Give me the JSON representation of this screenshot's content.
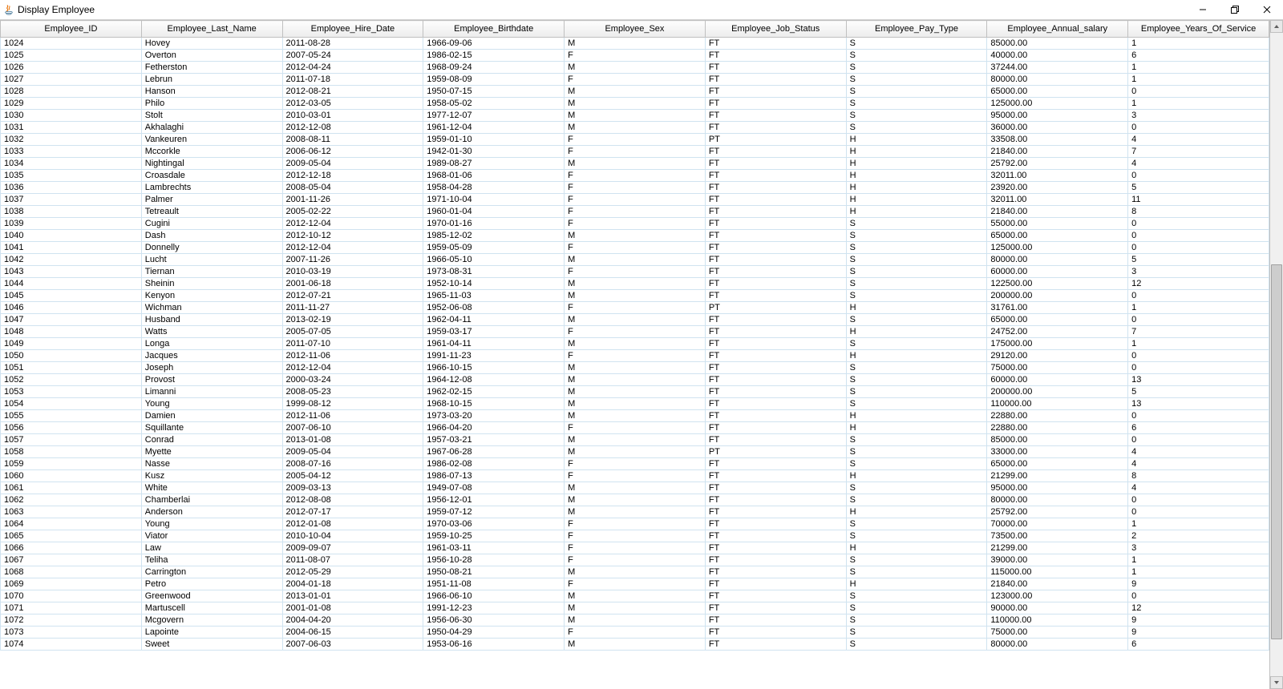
{
  "window": {
    "title": "Display Employee"
  },
  "columns": [
    "Employee_ID",
    "Employee_Last_Name",
    "Employee_Hire_Date",
    "Employee_Birthdate",
    "Employee_Sex",
    "Employee_Job_Status",
    "Employee_Pay_Type",
    "Employee_Annual_salary",
    "Employee_Years_Of_Service"
  ],
  "rows": [
    [
      "1024",
      "Hovey",
      "2011-08-28",
      "1966-09-06",
      "M",
      "FT",
      "S",
      "85000.00",
      "1"
    ],
    [
      "1025",
      "Overton",
      "2007-05-24",
      "1986-02-15",
      "F",
      "FT",
      "S",
      "40000.00",
      "6"
    ],
    [
      "1026",
      "Fetherston",
      "2012-04-24",
      "1968-09-24",
      "M",
      "FT",
      "S",
      "37244.00",
      "1"
    ],
    [
      "1027",
      "Lebrun",
      "2011-07-18",
      "1959-08-09",
      "F",
      "FT",
      "S",
      "80000.00",
      "1"
    ],
    [
      "1028",
      "Hanson",
      "2012-08-21",
      "1950-07-15",
      "M",
      "FT",
      "S",
      "65000.00",
      "0"
    ],
    [
      "1029",
      "Philo",
      "2012-03-05",
      "1958-05-02",
      "M",
      "FT",
      "S",
      "125000.00",
      "1"
    ],
    [
      "1030",
      "Stolt",
      "2010-03-01",
      "1977-12-07",
      "M",
      "FT",
      "S",
      "95000.00",
      "3"
    ],
    [
      "1031",
      "Akhalaghi",
      "2012-12-08",
      "1961-12-04",
      "M",
      "FT",
      "S",
      "36000.00",
      "0"
    ],
    [
      "1032",
      "Vankeuren",
      "2008-08-11",
      "1959-01-10",
      "F",
      "PT",
      "H",
      "33508.00",
      "4"
    ],
    [
      "1033",
      "Mccorkle",
      "2006-06-12",
      "1942-01-30",
      "F",
      "FT",
      "H",
      "21840.00",
      "7"
    ],
    [
      "1034",
      "Nightingal",
      "2009-05-04",
      "1989-08-27",
      "M",
      "FT",
      "H",
      "25792.00",
      "4"
    ],
    [
      "1035",
      "Croasdale",
      "2012-12-18",
      "1968-01-06",
      "F",
      "FT",
      "H",
      "32011.00",
      "0"
    ],
    [
      "1036",
      "Lambrechts",
      "2008-05-04",
      "1958-04-28",
      "F",
      "FT",
      "H",
      "23920.00",
      "5"
    ],
    [
      "1037",
      "Palmer",
      "2001-11-26",
      "1971-10-04",
      "F",
      "FT",
      "H",
      "32011.00",
      "11"
    ],
    [
      "1038",
      "Tetreault",
      "2005-02-22",
      "1960-01-04",
      "F",
      "FT",
      "H",
      "21840.00",
      "8"
    ],
    [
      "1039",
      "Cugini",
      "2012-12-04",
      "1970-01-16",
      "F",
      "FT",
      "S",
      "55000.00",
      "0"
    ],
    [
      "1040",
      "Dash",
      "2012-10-12",
      "1985-12-02",
      "M",
      "FT",
      "S",
      "65000.00",
      "0"
    ],
    [
      "1041",
      "Donnelly",
      "2012-12-04",
      "1959-05-09",
      "F",
      "FT",
      "S",
      "125000.00",
      "0"
    ],
    [
      "1042",
      "Lucht",
      "2007-11-26",
      "1966-05-10",
      "M",
      "FT",
      "S",
      "80000.00",
      "5"
    ],
    [
      "1043",
      "Tiernan",
      "2010-03-19",
      "1973-08-31",
      "F",
      "FT",
      "S",
      "60000.00",
      "3"
    ],
    [
      "1044",
      "Sheinin",
      "2001-06-18",
      "1952-10-14",
      "M",
      "FT",
      "S",
      "122500.00",
      "12"
    ],
    [
      "1045",
      "Kenyon",
      "2012-07-21",
      "1965-11-03",
      "M",
      "FT",
      "S",
      "200000.00",
      "0"
    ],
    [
      "1046",
      "Wichman",
      "2011-11-27",
      "1952-06-08",
      "F",
      "PT",
      "H",
      "31761.00",
      "1"
    ],
    [
      "1047",
      "Husband",
      "2013-02-19",
      "1962-04-11",
      "M",
      "FT",
      "S",
      "65000.00",
      "0"
    ],
    [
      "1048",
      "Watts",
      "2005-07-05",
      "1959-03-17",
      "F",
      "FT",
      "H",
      "24752.00",
      "7"
    ],
    [
      "1049",
      "Longa",
      "2011-07-10",
      "1961-04-11",
      "M",
      "FT",
      "S",
      "175000.00",
      "1"
    ],
    [
      "1050",
      "Jacques",
      "2012-11-06",
      "1991-11-23",
      "F",
      "FT",
      "H",
      "29120.00",
      "0"
    ],
    [
      "1051",
      "Joseph",
      "2012-12-04",
      "1966-10-15",
      "M",
      "FT",
      "S",
      "75000.00",
      "0"
    ],
    [
      "1052",
      "Provost",
      "2000-03-24",
      "1964-12-08",
      "M",
      "FT",
      "S",
      "60000.00",
      "13"
    ],
    [
      "1053",
      "Limanni",
      "2008-05-23",
      "1962-02-15",
      "M",
      "FT",
      "S",
      "200000.00",
      "5"
    ],
    [
      "1054",
      "Young",
      "1999-08-12",
      "1968-10-15",
      "M",
      "FT",
      "S",
      "110000.00",
      "13"
    ],
    [
      "1055",
      "Damien",
      "2012-11-06",
      "1973-03-20",
      "M",
      "FT",
      "H",
      "22880.00",
      "0"
    ],
    [
      "1056",
      "Squillante",
      "2007-06-10",
      "1966-04-20",
      "F",
      "FT",
      "H",
      "22880.00",
      "6"
    ],
    [
      "1057",
      "Conrad",
      "2013-01-08",
      "1957-03-21",
      "M",
      "FT",
      "S",
      "85000.00",
      "0"
    ],
    [
      "1058",
      "Myette",
      "2009-05-04",
      "1967-06-28",
      "M",
      "PT",
      "S",
      "33000.00",
      "4"
    ],
    [
      "1059",
      "Nasse",
      "2008-07-16",
      "1986-02-08",
      "F",
      "FT",
      "S",
      "65000.00",
      "4"
    ],
    [
      "1060",
      "Kusz",
      "2005-04-12",
      "1986-07-13",
      "F",
      "FT",
      "H",
      "21299.00",
      "8"
    ],
    [
      "1061",
      "White",
      "2009-03-13",
      "1949-07-08",
      "M",
      "FT",
      "S",
      "95000.00",
      "4"
    ],
    [
      "1062",
      "Chamberlai",
      "2012-08-08",
      "1956-12-01",
      "M",
      "FT",
      "S",
      "80000.00",
      "0"
    ],
    [
      "1063",
      "Anderson",
      "2012-07-17",
      "1959-07-12",
      "M",
      "FT",
      "H",
      "25792.00",
      "0"
    ],
    [
      "1064",
      "Young",
      "2012-01-08",
      "1970-03-06",
      "F",
      "FT",
      "S",
      "70000.00",
      "1"
    ],
    [
      "1065",
      "Viator",
      "2010-10-04",
      "1959-10-25",
      "F",
      "FT",
      "S",
      "73500.00",
      "2"
    ],
    [
      "1066",
      "Law",
      "2009-09-07",
      "1961-03-11",
      "F",
      "FT",
      "H",
      "21299.00",
      "3"
    ],
    [
      "1067",
      "Teliha",
      "2011-08-07",
      "1956-10-28",
      "F",
      "FT",
      "S",
      "39000.00",
      "1"
    ],
    [
      "1068",
      "Carrington",
      "2012-05-29",
      "1950-08-21",
      "M",
      "FT",
      "S",
      "115000.00",
      "1"
    ],
    [
      "1069",
      "Petro",
      "2004-01-18",
      "1951-11-08",
      "F",
      "FT",
      "H",
      "21840.00",
      "9"
    ],
    [
      "1070",
      "Greenwood",
      "2013-01-01",
      "1966-06-10",
      "M",
      "FT",
      "S",
      "123000.00",
      "0"
    ],
    [
      "1071",
      "Martuscell",
      "2001-01-08",
      "1991-12-23",
      "M",
      "FT",
      "S",
      "90000.00",
      "12"
    ],
    [
      "1072",
      "Mcgovern",
      "2004-04-20",
      "1956-06-30",
      "M",
      "FT",
      "S",
      "110000.00",
      "9"
    ],
    [
      "1073",
      "Lapointe",
      "2004-06-15",
      "1950-04-29",
      "F",
      "FT",
      "S",
      "75000.00",
      "9"
    ],
    [
      "1074",
      "Sweet",
      "2007-06-03",
      "1953-06-16",
      "M",
      "FT",
      "S",
      "80000.00",
      "6"
    ]
  ]
}
